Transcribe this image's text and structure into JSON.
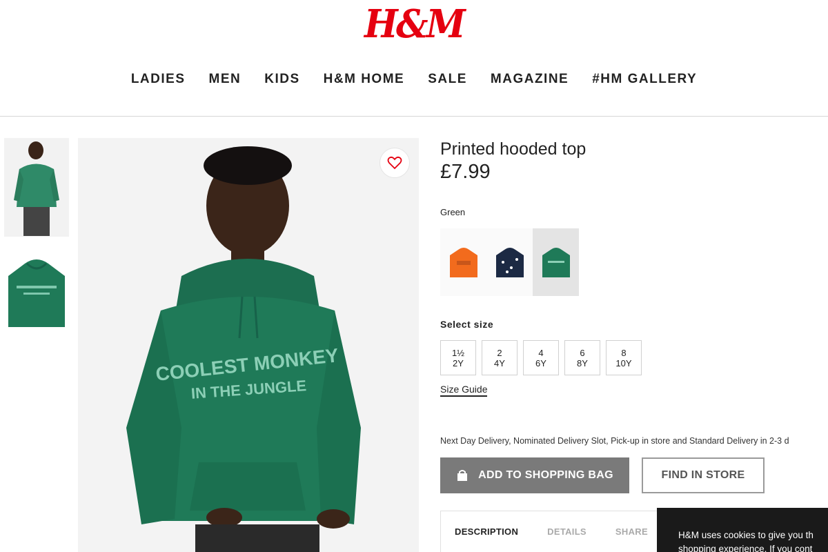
{
  "header": {
    "logo": "H&M",
    "nav": [
      "LADIES",
      "MEN",
      "KIDS",
      "H&M HOME",
      "SALE",
      "MAGAZINE",
      "#HM GALLERY"
    ]
  },
  "product": {
    "title": "Printed hooded top",
    "price": "£7.99",
    "hoodie_print_line1": "COOLEST MONKEY",
    "hoodie_print_line2": "IN THE JUNGLE",
    "color_name": "Green",
    "swatches": [
      {
        "name": "orange-hoodie",
        "color": "#f26b1d"
      },
      {
        "name": "navy-hoodie",
        "color": "#1c2a44"
      },
      {
        "name": "green-hoodie",
        "color": "#1f7a58",
        "selected": true
      }
    ],
    "select_size_label": "Select size",
    "sizes": [
      {
        "top": "1½",
        "bottom": "2Y"
      },
      {
        "top": "2",
        "bottom": "4Y"
      },
      {
        "top": "4",
        "bottom": "6Y"
      },
      {
        "top": "6",
        "bottom": "8Y"
      },
      {
        "top": "8",
        "bottom": "10Y"
      }
    ],
    "size_guide": "Size Guide",
    "delivery_text": "Next Day Delivery, Nominated Delivery Slot, Pick-up in store and Standard Delivery in 2-3 d",
    "add_to_bag": "ADD TO SHOPPING BAG",
    "find_in_store": "FIND IN STORE",
    "tabs": [
      "DESCRIPTION",
      "DETAILS",
      "SHARE"
    ]
  },
  "cookie": {
    "line1": "H&M uses cookies to give you th",
    "line2": "shopping experience. If you cont"
  },
  "colors": {
    "brand_red": "#e50010",
    "hoodie_green": "#1f7a58",
    "button_grey": "#7a7a7a"
  }
}
